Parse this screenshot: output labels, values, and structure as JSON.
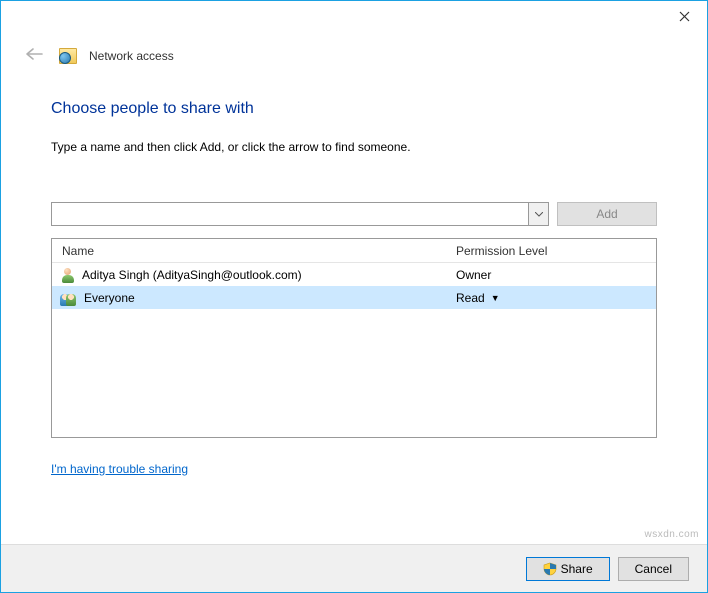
{
  "window": {
    "title": "Network access"
  },
  "page": {
    "heading": "Choose people to share with",
    "instruction": "Type a name and then click Add, or click the arrow to find someone."
  },
  "input": {
    "value": "",
    "add_label": "Add"
  },
  "table": {
    "headers": {
      "name": "Name",
      "permission": "Permission Level"
    },
    "rows": [
      {
        "name": "Aditya Singh (AdityaSingh@outlook.com)",
        "permission": "Owner",
        "selected": false,
        "icon": "user"
      },
      {
        "name": "Everyone",
        "permission": "Read",
        "selected": true,
        "icon": "group",
        "dropdown": true
      }
    ]
  },
  "help_link": "I'm having trouble sharing",
  "footer": {
    "share_label": "Share",
    "cancel_label": "Cancel"
  },
  "watermark": "wsxdn.com"
}
